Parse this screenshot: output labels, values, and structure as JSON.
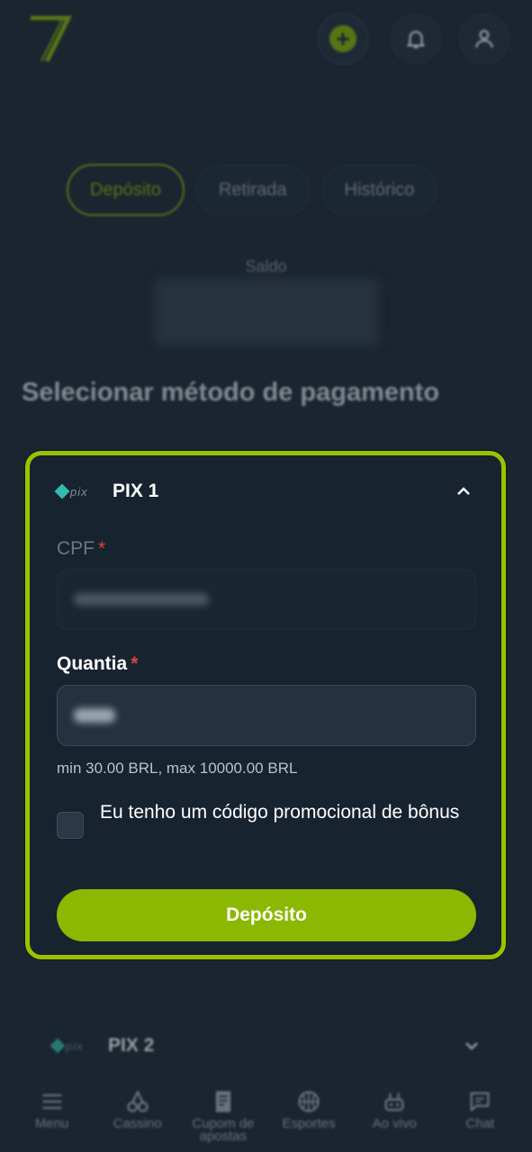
{
  "header": {
    "logo_icon": "brand-7-logo",
    "add_icon": "plus-icon",
    "bell_icon": "bell-icon",
    "user_icon": "user-icon",
    "accent_color": "#8bb800"
  },
  "tabs": [
    {
      "label": "Depósito",
      "active": true
    },
    {
      "label": "Retirada",
      "active": false
    },
    {
      "label": "Histórico",
      "active": false
    }
  ],
  "balance": {
    "label": "Saldo"
  },
  "section_title": "Selecionar método de pagamento",
  "methods": [
    {
      "name": "PIX 1",
      "logo_text": "pix",
      "expanded": true,
      "cpf_label": "CPF",
      "amount_label": "Quantia",
      "required_mark": "*",
      "limits_hint": "min 30.00 BRL, max 10000.00 BRL",
      "promo_checkbox_label": "Eu tenho um código promocional de bônus",
      "promo_checked": false,
      "submit_label": "Depósito"
    },
    {
      "name": "PIX 2",
      "logo_text": "pix",
      "expanded": false
    }
  ],
  "bottom_nav": [
    {
      "label": "Menu",
      "icon": "menu-icon"
    },
    {
      "label": "Cassino",
      "icon": "cherries-icon"
    },
    {
      "label": "Cupom de apostas",
      "icon": "ticket-icon"
    },
    {
      "label": "Esportes",
      "icon": "basketball-icon"
    },
    {
      "label": "Ao vivo",
      "icon": "live-icon"
    },
    {
      "label": "Chat",
      "icon": "chat-icon"
    }
  ]
}
